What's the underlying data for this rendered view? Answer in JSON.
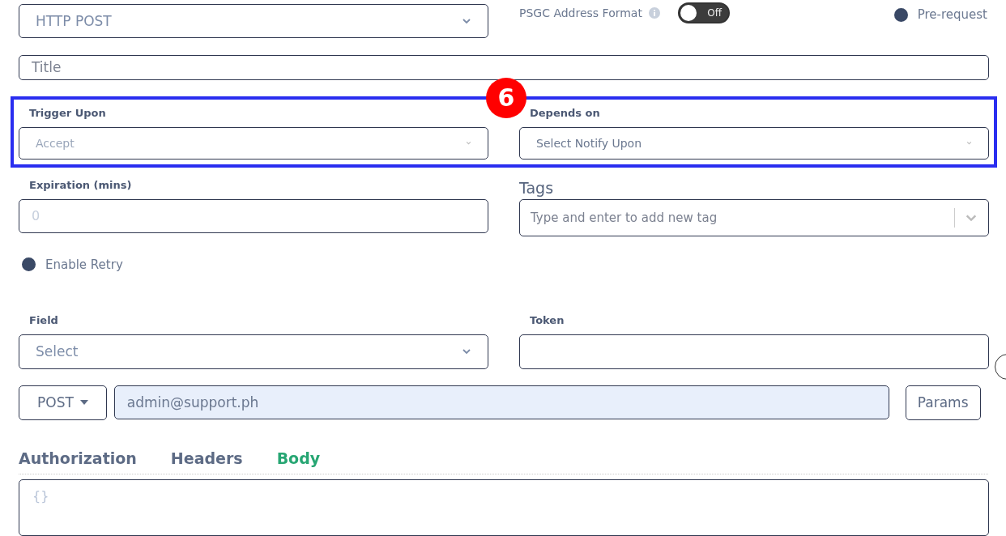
{
  "method_select": {
    "value": "HTTP POST"
  },
  "psgc": {
    "label": "PSGC Address Format",
    "toggle": {
      "on": false,
      "label": "Off"
    }
  },
  "pre_request": {
    "label": "Pre-request",
    "checked": true
  },
  "title_field": {
    "placeholder": "Title"
  },
  "annotation": {
    "number": "6"
  },
  "trigger_upon": {
    "label": "Trigger Upon",
    "placeholder": "Accept",
    "disabled": true
  },
  "depends_on": {
    "label": "Depends on",
    "placeholder": "Select Notify Upon",
    "disabled": false
  },
  "expiration": {
    "label": "Expiration (mins)",
    "placeholder": "0"
  },
  "tags": {
    "label": "Tags",
    "placeholder": "Type and enter to add new tag"
  },
  "enable_retry": {
    "label": "Enable Retry",
    "checked": true
  },
  "field": {
    "label": "Field",
    "placeholder": "Select"
  },
  "token": {
    "label": "Token"
  },
  "request": {
    "method": "POST",
    "url": "admin@support.ph",
    "params": "Params"
  },
  "tabs": [
    {
      "label": "Authorization",
      "selected": false
    },
    {
      "label": "Headers",
      "selected": false
    },
    {
      "label": "Body",
      "selected": true
    }
  ],
  "body": {
    "placeholder": "{}"
  }
}
